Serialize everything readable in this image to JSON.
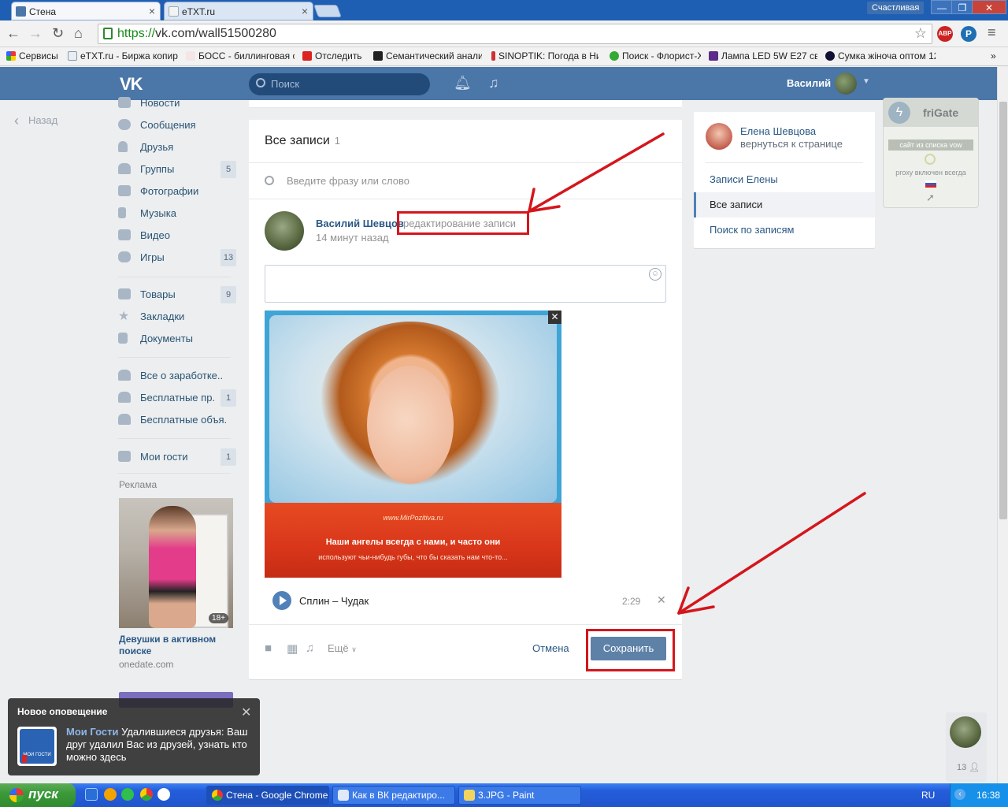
{
  "browser": {
    "tabs": [
      {
        "title": "Стена",
        "active": true
      },
      {
        "title": "eTXT.ru",
        "active": false
      }
    ],
    "profile_name": "Счастливая",
    "url_scheme": "https://",
    "url_rest": "vk.com/wall51500280",
    "bookmarks": [
      "Сервисы",
      "eTXT.ru - Биржа копир",
      "БОСС - биллинговая ог",
      "Отследить",
      "Семантический анализ",
      "SINOPTIK: Погода в Ни",
      "Поиск - Флорист-Х",
      "Лампа LED 5W E27 свет",
      "Сумка жіноча оптом 12"
    ],
    "ext_abp": "ABP"
  },
  "vk": {
    "logo": "VK",
    "search_placeholder": "Поиск",
    "user_name": "Василий",
    "back": "Назад",
    "nav": [
      {
        "label": "Новости",
        "count": ""
      },
      {
        "label": "Сообщения",
        "count": ""
      },
      {
        "label": "Друзья",
        "count": ""
      },
      {
        "label": "Группы",
        "count": "5"
      },
      {
        "label": "Фотографии",
        "count": ""
      },
      {
        "label": "Музыка",
        "count": ""
      },
      {
        "label": "Видео",
        "count": ""
      },
      {
        "label": "Игры",
        "count": "13"
      },
      {
        "label": "Товары",
        "count": "9"
      },
      {
        "label": "Закладки",
        "count": ""
      },
      {
        "label": "Документы",
        "count": ""
      },
      {
        "label": "Все о заработке..",
        "count": ""
      },
      {
        "label": "Бесплатные пр...",
        "count": "1"
      },
      {
        "label": "Бесплатные объя..",
        "count": ""
      },
      {
        "label": "Мои гости",
        "count": "1"
      }
    ],
    "ad": {
      "label": "Реклама",
      "age": "18+",
      "caption": "Девушки в активном поиске",
      "domain": "onedate.com"
    }
  },
  "post": {
    "header": "Все записи",
    "header_count": "1",
    "search_placeholder": "Введите фразу или слово",
    "author": "Василий Шевцов",
    "edit_label": "редактирование записи",
    "time": "14 минут назад",
    "photo_watermark": "www.MirPozitiva.ru",
    "photo_line1": "Наши ангелы всегда с нами,  и часто они",
    "photo_line2": "используют чьи-нибудь губы, что бы сказать нам что-то...",
    "audio_title": "Сплин – Чудак",
    "audio_duration": "2:29",
    "more": "Ещё",
    "cancel": "Отмена",
    "save": "Сохранить"
  },
  "right_menu": {
    "name": "Елена Шевцова",
    "back": "вернуться к странице",
    "items": [
      {
        "label": "Записи Елены",
        "selected": false
      },
      {
        "label": "Все записи",
        "selected": true
      },
      {
        "label": "Поиск по записям",
        "selected": false
      }
    ]
  },
  "frigate": {
    "title": "friGate",
    "list_btn": "сайт из списка vow",
    "status": "proxy включен всегда"
  },
  "chat": {
    "count": "13"
  },
  "notification": {
    "title": "Новое оповещение",
    "app": "Мои Гости",
    "text": "Удалившиеся друзья: Ваш друг удалил Вас из друзей, узнать кто можно здесь",
    "icon_text": "МОИ ГОСТИ"
  },
  "taskbar": {
    "start": "пуск",
    "tasks": [
      {
        "label": "Стена - Google Chrome",
        "active": true
      },
      {
        "label": "Как в ВК редактиро...",
        "active": false
      },
      {
        "label": "3.JPG - Paint",
        "active": false
      }
    ],
    "lang": "RU",
    "time": "16:38"
  },
  "colors": {
    "vk_header": "#4a76a8",
    "link": "#2a5885",
    "annotation_red": "#d4161c",
    "save_button": "#5e81a8"
  }
}
